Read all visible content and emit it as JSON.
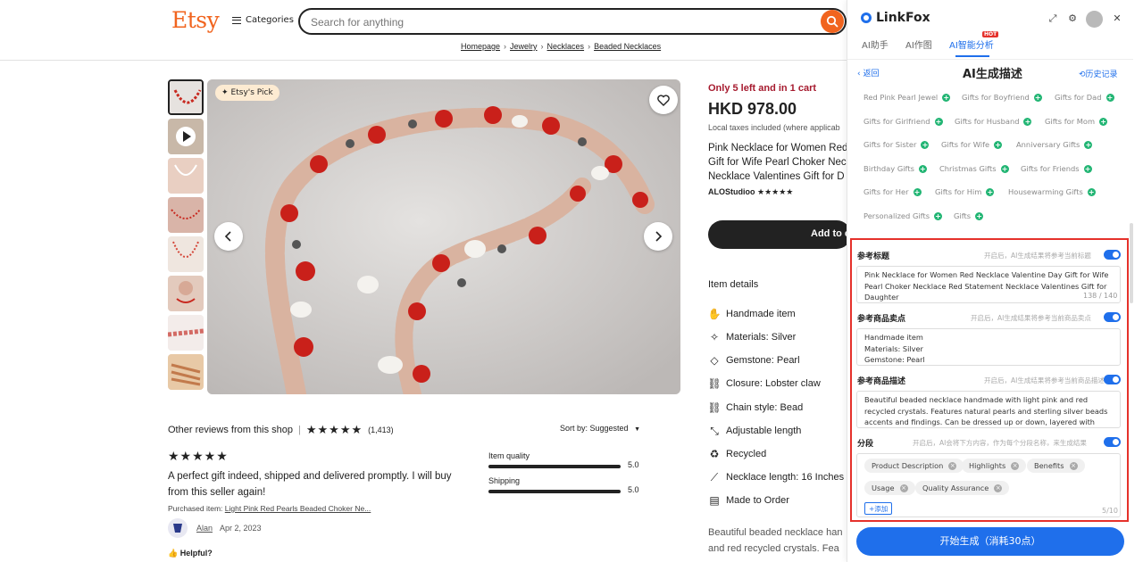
{
  "header": {
    "logo": "Etsy",
    "categories_label": "Categories",
    "search_placeholder": "Search for anything",
    "breadcrumb": [
      "Homepage",
      "Jewelry",
      "Necklaces",
      "Beaded Necklaces"
    ]
  },
  "gallery": {
    "badge": "Etsy's Pick",
    "thumbnail_count": 8
  },
  "reviews": {
    "header_label": "Other reviews from this shop",
    "stars": "★★★★★",
    "count": "(1,413)",
    "sort_label": "Sort by: Suggested",
    "review_stars": "★★★★★",
    "review_text": "A perfect gift indeed, shipped and delivered promptly. I will buy from this seller again!",
    "purchased_label": "Purchased item:",
    "purchased_item": "Light Pink Red Pearls Beaded Choker Ne...",
    "user": "Alan",
    "date": "Apr 2, 2023",
    "helpful": "Helpful?",
    "ratings": [
      {
        "label": "Item quality",
        "value": "5.0",
        "fraction": 1.0
      },
      {
        "label": "Shipping",
        "value": "5.0",
        "fraction": 1.0
      }
    ]
  },
  "product": {
    "stock": "Only 5 left and in 1 cart",
    "price": "HKD 978.00",
    "tax": "Local taxes included (where applicab",
    "title_lines": [
      "Pink Necklace for Women Red",
      "Gift for Wife Pearl Choker Nec",
      "Necklace Valentines Gift for D"
    ],
    "shop": "ALOStudioo",
    "shop_stars": "★★★★★",
    "add_to_cart": "Add to c",
    "item_details_label": "Item details",
    "details": [
      {
        "icon": "hand-icon",
        "text": "Handmade item"
      },
      {
        "icon": "sparkle-icon",
        "text": "Materials: Silver"
      },
      {
        "icon": "diamond-icon",
        "text": "Gemstone: Pearl"
      },
      {
        "icon": "link-icon",
        "text": "Closure: Lobster claw"
      },
      {
        "icon": "link-icon",
        "text": "Chain style: Bead"
      },
      {
        "icon": "resize-icon",
        "text": "Adjustable length"
      },
      {
        "icon": "recycle-icon",
        "text": "Recycled"
      },
      {
        "icon": "ruler-icon",
        "text": "Necklace length: 16 Inches"
      },
      {
        "icon": "document-icon",
        "text": "Made to Order"
      }
    ],
    "description_lines": [
      "Beautiful beaded necklace han",
      "and red recycled crystals. Fea"
    ]
  },
  "panel": {
    "brand": "LinkFox",
    "tabs": [
      "AI助手",
      "AI作图",
      "AI智能分析"
    ],
    "hot_badge": "HOT",
    "back_label": "返回",
    "title": "AI生成描述",
    "history_label": "历史记录",
    "keywords": [
      [
        "Red Pink Pearl Jewel",
        "Gifts for Boyfriend",
        "Gifts for Dad"
      ],
      [
        "Gifts for Girlfriend",
        "Gifts for Husband",
        "Gifts for Mom"
      ],
      [
        "Gifts for Sister",
        "Gifts for Wife",
        "Anniversary Gifts"
      ],
      [
        "Birthday Gifts",
        "Christmas Gifts",
        "Gifts for Friends"
      ],
      [
        "Gifts for Her",
        "Gifts for Him",
        "Housewarming Gifts"
      ],
      [
        "Personalized Gifts",
        "Gifts"
      ]
    ],
    "sections": {
      "ref_title": {
        "label": "参考标题",
        "hint": "开启后，AI生成结果将参考当前标题",
        "text": "Pink Necklace for Women Red Necklace Valentine Day Gift for Wife Pearl Choker Necklace Red Statement Necklace Valentines Gift for Daughter",
        "count": "138 / 140"
      },
      "ref_points": {
        "label": "参考商品卖点",
        "hint": "开启后，AI生成结果将参考当前商品卖点",
        "lines": [
          "Handmade item",
          "Materials: Silver",
          "Gemstone: Pearl"
        ]
      },
      "ref_desc": {
        "label": "参考商品描述",
        "hint": "开启后，AI生成结果将参考当前商品描述",
        "text": "Beautiful beaded necklace handmade with light pink and red recycled crystals. Features natural pearls and sterling silver beads accents and findings. Can be dressed up or down, layered with other necklaces or"
      },
      "segments": {
        "label": "分段",
        "hint": "开启后，AI会将下方内容，作为每个分段名称，来生成结果",
        "chips": [
          "Product Description",
          "Highlights",
          "Benefits",
          "Usage",
          "Quality Assurance"
        ],
        "add_label": "+添加",
        "count": "5/10"
      }
    },
    "generate_button": "开始生成（消耗30点）"
  },
  "colors": {
    "etsy_orange": "#f1641e",
    "stock_red": "#a61a2e",
    "linkfox_blue": "#1f6feb",
    "keyword_plus": "#21b573",
    "highlight_red": "#e5312b"
  }
}
